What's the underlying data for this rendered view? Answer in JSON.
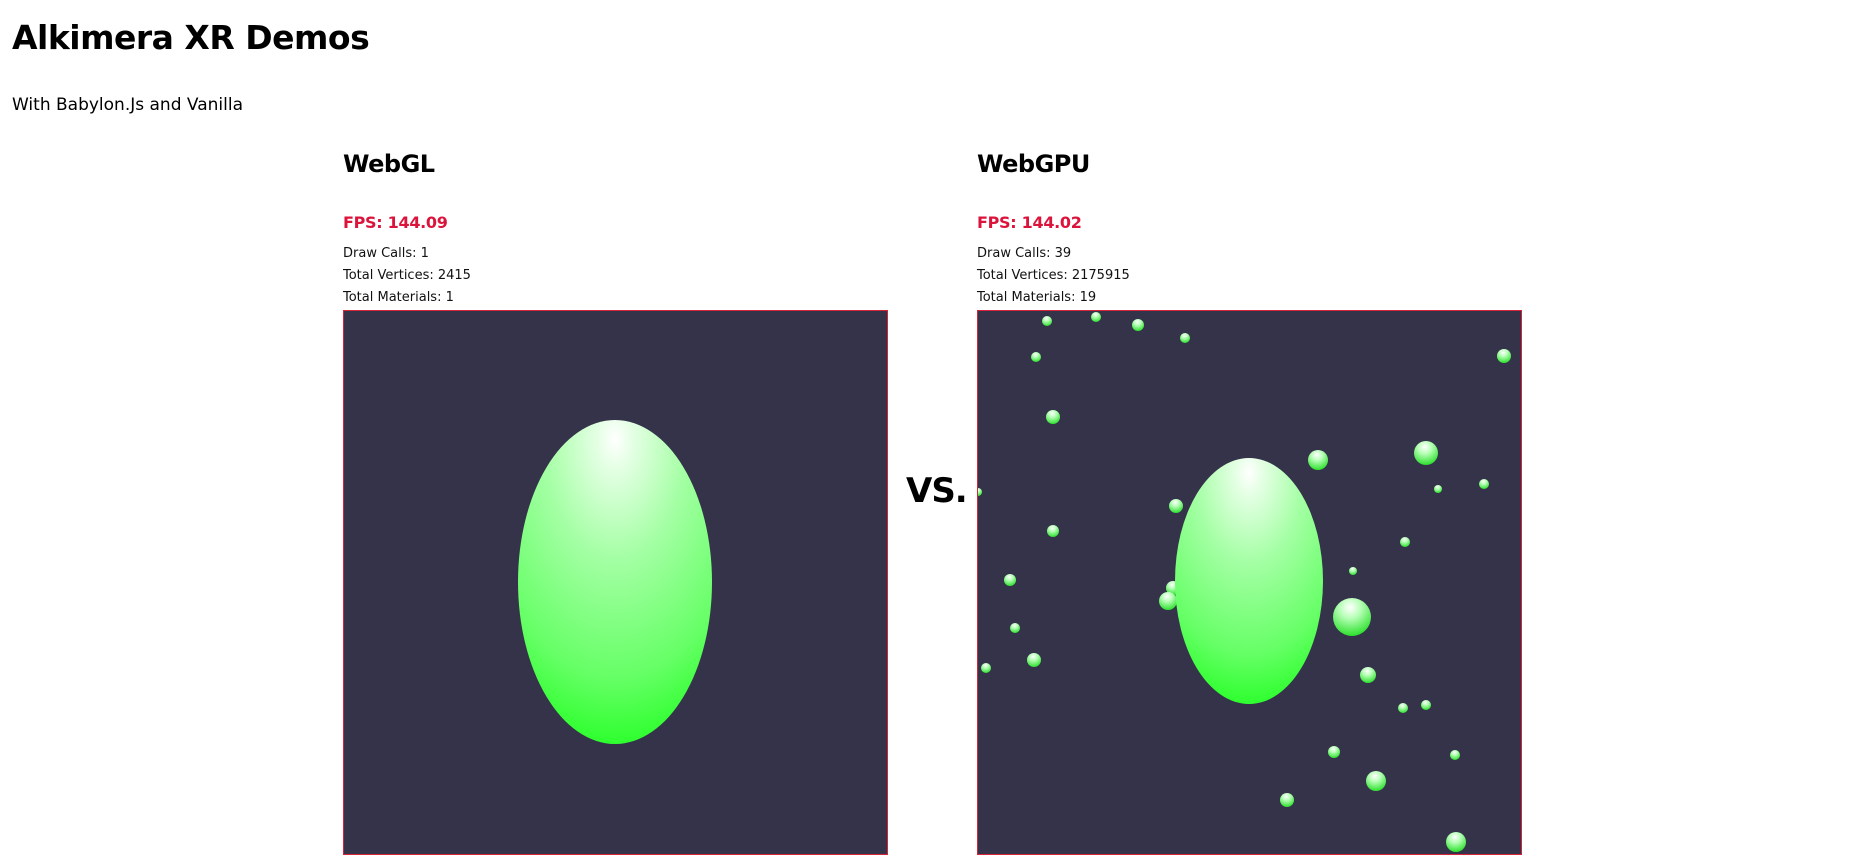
{
  "header": {
    "title": "Alkimera XR Demos",
    "subtitle": "With Babylon.Js and Vanilla"
  },
  "separator": "VS.",
  "panels": [
    {
      "title": "WebGL",
      "fps": "FPS: 144.09",
      "draw_calls": "Draw Calls: 1",
      "total_vertices": "Total Vertices: 2415",
      "total_materials": "Total Materials: 1"
    },
    {
      "title": "WebGPU",
      "fps": "FPS: 144.02",
      "draw_calls": "Draw Calls: 39",
      "total_vertices": "Total Vertices: 2175915",
      "total_materials": "Total Materials: 19"
    }
  ],
  "colors": {
    "fps_text": "#dc143c",
    "canvas_background": "#34334a",
    "canvas_border": "#d6253a",
    "sphere_green": "#22ff22"
  }
}
